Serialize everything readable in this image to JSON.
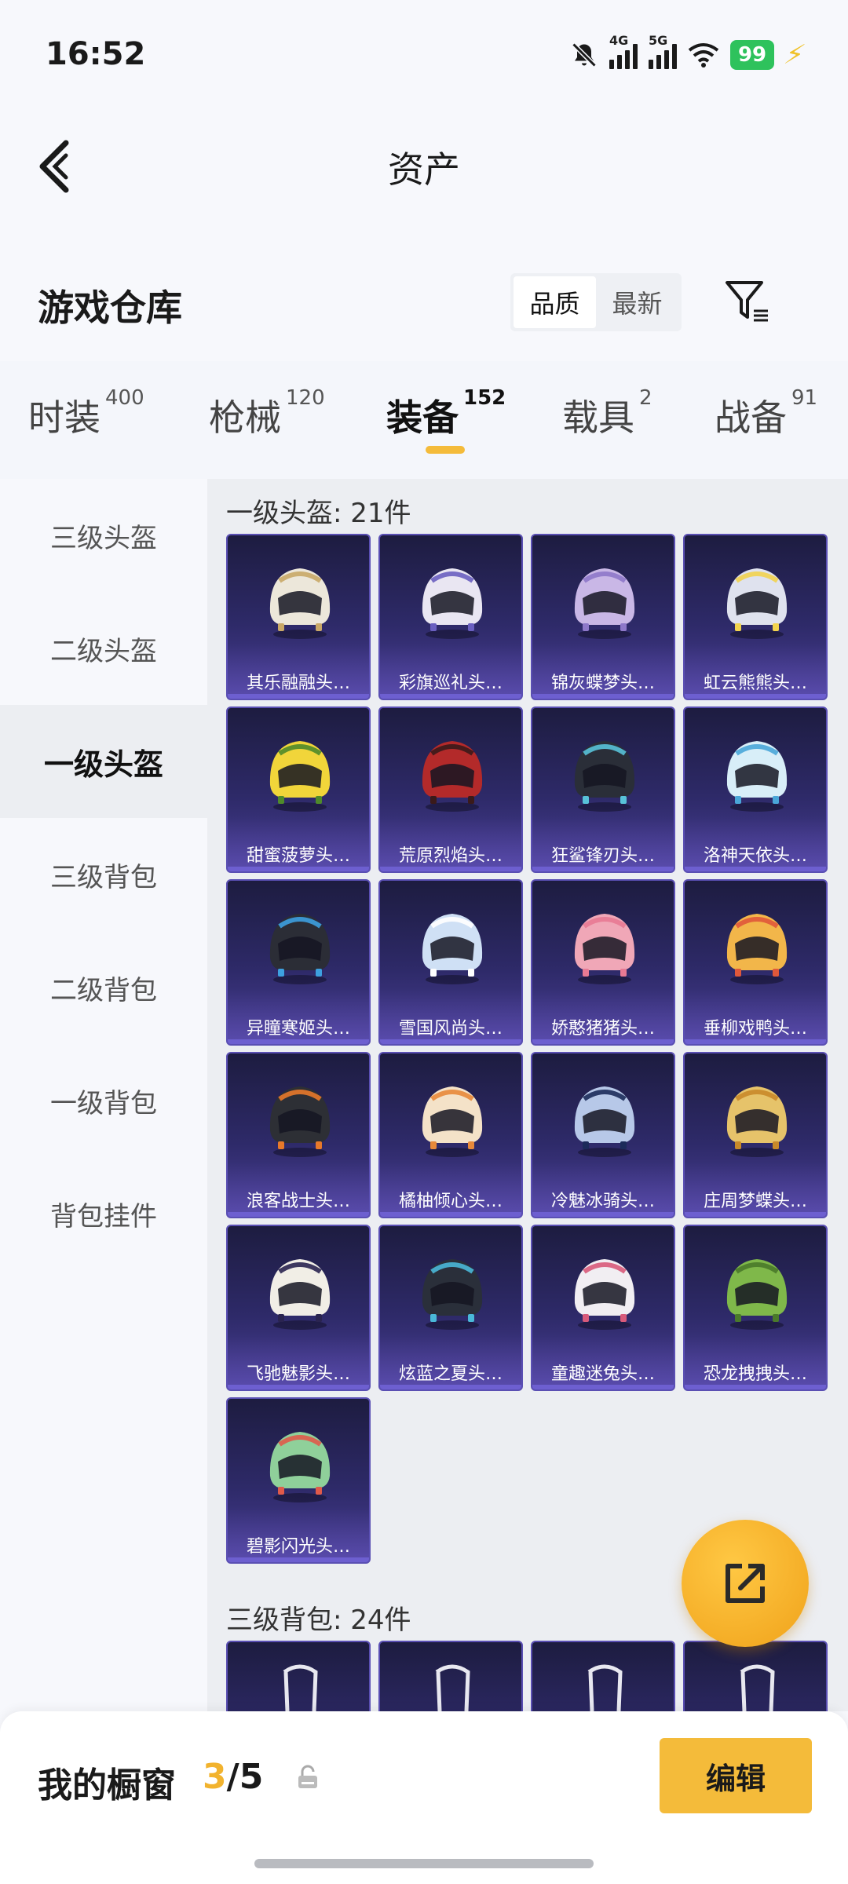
{
  "status_bar": {
    "time": "16:52",
    "net1": "4G",
    "net2": "5G",
    "battery": "99",
    "icons": [
      "mute-bell-icon",
      "signal-icon",
      "wifi-icon",
      "battery-icon",
      "charging-icon"
    ]
  },
  "header": {
    "title": "资产"
  },
  "warehouse": {
    "title": "游戏仓库",
    "sort_options": [
      "品质",
      "最新"
    ],
    "active_sort": "品质"
  },
  "tabs": [
    {
      "label": "时装",
      "count": "400"
    },
    {
      "label": "枪械",
      "count": "120"
    },
    {
      "label": "装备",
      "count": "152"
    },
    {
      "label": "载具",
      "count": "2"
    },
    {
      "label": "战备",
      "count": "91"
    }
  ],
  "active_tab": "装备",
  "sidebar": [
    {
      "label": "三级头盔"
    },
    {
      "label": "二级头盔"
    },
    {
      "label": "一级头盔"
    },
    {
      "label": "三级背包"
    },
    {
      "label": "二级背包"
    },
    {
      "label": "一级背包"
    },
    {
      "label": "背包挂件"
    }
  ],
  "active_sidebar": "一级头盔",
  "sections": [
    {
      "title": "一级头盔: 21件",
      "items": [
        {
          "name": "其乐融融头…",
          "color": "#ece7da",
          "accent": "#c9a867"
        },
        {
          "name": "彩旗巡礼头…",
          "color": "#e9e6f2",
          "accent": "#6a5fc0"
        },
        {
          "name": "锦灰蝶梦头…",
          "color": "#c9b7e6",
          "accent": "#8e78c9"
        },
        {
          "name": "虹云熊熊头…",
          "color": "#dfe2ee",
          "accent": "#f2d34e"
        },
        {
          "name": "甜蜜菠萝头…",
          "color": "#f1d53a",
          "accent": "#4f8a2a"
        },
        {
          "name": "荒原烈焰头…",
          "color": "#b32a2a",
          "accent": "#3a1a1a"
        },
        {
          "name": "狂鲨锋刃头…",
          "color": "#2a2e38",
          "accent": "#58c2d8"
        },
        {
          "name": "洛神天依头…",
          "color": "#d8eef8",
          "accent": "#4aa6d8"
        },
        {
          "name": "异瞳寒姬头…",
          "color": "#2b2d36",
          "accent": "#3da0e0"
        },
        {
          "name": "雪国风尚头…",
          "color": "#cfe0f5",
          "accent": "#ffffff"
        },
        {
          "name": "娇憨猪猪头…",
          "color": "#f0a7b7",
          "accent": "#e87a94"
        },
        {
          "name": "垂柳戏鸭头…",
          "color": "#f2b64a",
          "accent": "#e0583a"
        },
        {
          "name": "浪客战士头…",
          "color": "#2d2f35",
          "accent": "#e8792a"
        },
        {
          "name": "橘柚倾心头…",
          "color": "#f4e2c8",
          "accent": "#e8893a"
        },
        {
          "name": "冷魅冰骑头…",
          "color": "#b7c8e8",
          "accent": "#1c2b5a"
        },
        {
          "name": "庄周梦蝶头…",
          "color": "#e6c36a",
          "accent": "#c98a2a"
        },
        {
          "name": "飞驰魅影头…",
          "color": "#f1eee6",
          "accent": "#2a2450"
        },
        {
          "name": "炫蓝之夏头…",
          "color": "#2a2f3a",
          "accent": "#4ab8d8"
        },
        {
          "name": "童趣迷兔头…",
          "color": "#f1eef2",
          "accent": "#d85a7a"
        },
        {
          "name": "恐龙拽拽头…",
          "color": "#7fb84a",
          "accent": "#4a7a2a"
        },
        {
          "name": "碧影闪光头…",
          "color": "#8fd09a",
          "accent": "#e05a4a"
        }
      ]
    },
    {
      "title": "三级背包: 24件",
      "items": [
        {
          "name": "",
          "color": "#ffffff",
          "accent": "#ffffff"
        },
        {
          "name": "",
          "color": "#ffffff",
          "accent": "#ffffff"
        },
        {
          "name": "",
          "color": "#ffffff",
          "accent": "#ffffff"
        },
        {
          "name": "",
          "color": "#ffffff",
          "accent": "#ffffff"
        }
      ]
    }
  ],
  "share_button": {
    "icon": "share-external-icon"
  },
  "bottom_bar": {
    "label": "我的橱窗",
    "current": "3",
    "separator": "/",
    "total": "5",
    "edit_label": "编辑",
    "lock_icon": "lock-icon"
  },
  "colors": {
    "accent": "#f4bb3a",
    "card_bg": "#2e2a69",
    "battery": "#2ec25c"
  }
}
